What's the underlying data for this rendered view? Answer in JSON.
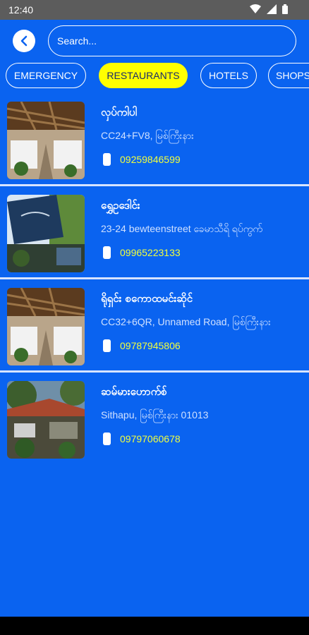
{
  "status": {
    "time": "12:40"
  },
  "search": {
    "placeholder": "Search..."
  },
  "categories": [
    {
      "label": "EMERGENCY",
      "active": false
    },
    {
      "label": "RESTAURANTS",
      "active": true
    },
    {
      "label": "HOTELS",
      "active": false
    },
    {
      "label": "SHOPS",
      "active": false
    }
  ],
  "places": [
    {
      "name": "လှပ်ကါပါ",
      "address": "CC24+FV8, မြစ်ကြီးနား",
      "phone": "09259846599",
      "photo": "restaurant-hall"
    },
    {
      "name": "ရွှေဥဒေါင်း",
      "address": "23-24 bewteenstreet ခေမာသီရိ ရပ်ကွက်",
      "phone": "09965223133",
      "photo": "restaurant-sign"
    },
    {
      "name": "ရိုရှင်း စကောထမင်းဆိုင်",
      "address": "CC32+6QR, Unnamed Road, မြစ်ကြီးနား",
      "phone": "09787945806",
      "photo": "restaurant-hall"
    },
    {
      "name": "ဆမ်မားဟောက်စ်",
      "address": "Sithapu, မြစ်ကြီးနား 01013",
      "phone": "09797060678",
      "photo": "restaurant-garden"
    }
  ],
  "colors": {
    "background": "#0a63f0",
    "active_chip": "#ffff00",
    "phone_text": "#f1ff3d"
  }
}
